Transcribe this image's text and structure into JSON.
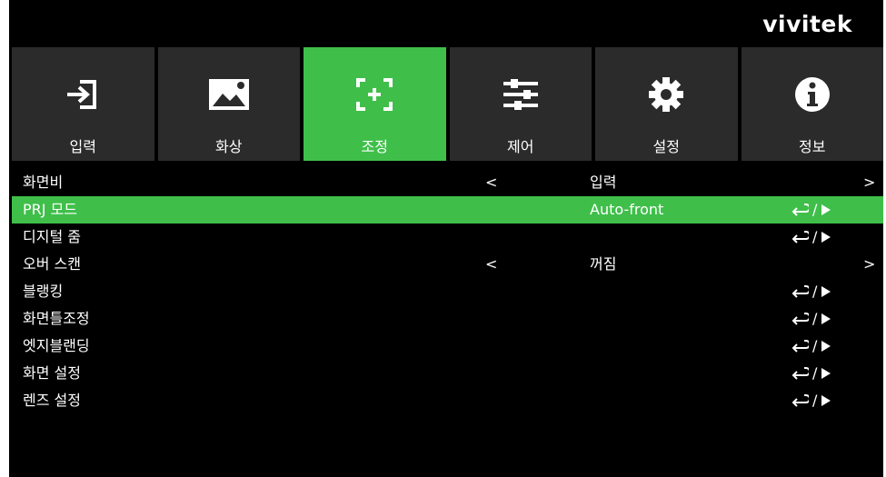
{
  "brand": {
    "logo": "vivitek"
  },
  "tabs": [
    {
      "label": "입력",
      "icon": "input-icon",
      "active": false
    },
    {
      "label": "화상",
      "icon": "image-icon",
      "active": false
    },
    {
      "label": "조정",
      "icon": "adjust-icon",
      "active": true
    },
    {
      "label": "제어",
      "icon": "sliders-icon",
      "active": false
    },
    {
      "label": "설정",
      "icon": "gear-icon",
      "active": false
    },
    {
      "label": "정보",
      "icon": "info-icon",
      "active": false
    }
  ],
  "menu": {
    "rows": [
      {
        "name": "화면비",
        "type": "select",
        "left_arrow": "<",
        "value": "입력",
        "right_arrow": ">",
        "selected": false
      },
      {
        "name": "PRJ 모드",
        "type": "select-enter",
        "value": "Auto-front",
        "selected": true
      },
      {
        "name": "디지털 줌",
        "type": "enter",
        "selected": false
      },
      {
        "name": "오버 스캔",
        "type": "select",
        "left_arrow": "<",
        "value": "꺼짐",
        "right_arrow": ">",
        "selected": false
      },
      {
        "name": "블랭킹",
        "type": "enter",
        "selected": false
      },
      {
        "name": "화면틀조정",
        "type": "enter",
        "selected": false
      },
      {
        "name": "엣지블랜딩",
        "type": "enter",
        "selected": false
      },
      {
        "name": "화면 설정",
        "type": "enter",
        "selected": false
      },
      {
        "name": "렌즈 설정",
        "type": "enter",
        "selected": false
      }
    ],
    "enter_separator": "/"
  },
  "colors": {
    "accent": "#3fbf4a",
    "tab_bg": "#2b2b2b",
    "background": "#000000",
    "text": "#ffffff"
  }
}
